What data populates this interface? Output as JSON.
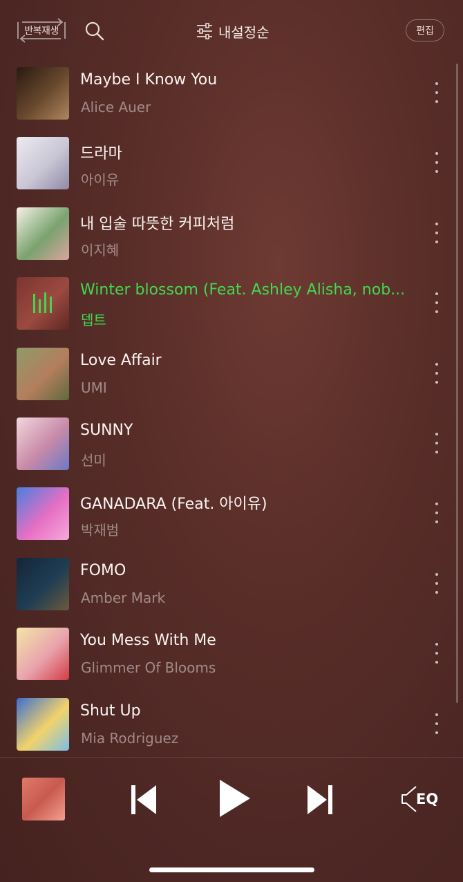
{
  "header": {
    "repeat_label": "반복재생",
    "sort_label": "내설정순",
    "edit_label": "편집"
  },
  "tracks": [
    {
      "title": "Maybe I Know You",
      "artist": "Alice Auer",
      "art_colors": [
        "#2a1a12",
        "#6a4a2e",
        "#b08660"
      ]
    },
    {
      "title": "드라마",
      "artist": "아이유",
      "art_colors": [
        "#ecebef",
        "#c9c6d6",
        "#8f8aa6"
      ]
    },
    {
      "title": "내 입술 따뜻한 커피처럼",
      "artist": "이지혜",
      "art_colors": [
        "#f5f1e6",
        "#7aa36f",
        "#d9a4a0"
      ]
    },
    {
      "title": "Winter blossom (Feat. Ashley Alisha, nob...",
      "artist": "뎁트",
      "art_colors": [
        "#7a3530",
        "#9b4a40",
        "#5e2824"
      ],
      "playing": true
    },
    {
      "title": "Love Affair",
      "artist": "UMI",
      "art_colors": [
        "#8f9a6a",
        "#b47e5c",
        "#5d6a3e"
      ]
    },
    {
      "title": "SUNNY",
      "artist": "선미",
      "art_colors": [
        "#f3d6dc",
        "#c78aa8",
        "#6c79c6"
      ]
    },
    {
      "title": "GANADARA (Feat. 아이유)",
      "artist": "박재범",
      "art_colors": [
        "#4a7fe0",
        "#e66fc3",
        "#f6a9dc"
      ]
    },
    {
      "title": "FOMO",
      "artist": "Amber Mark",
      "art_colors": [
        "#13263a",
        "#1f3d54",
        "#6b5a3c"
      ]
    },
    {
      "title": "You Mess With Me",
      "artist": "Glimmer Of Blooms",
      "art_colors": [
        "#f4e5a8",
        "#e8a3ad",
        "#d33b45"
      ]
    },
    {
      "title": "Shut Up",
      "artist": "Mia Rodriguez",
      "art_colors": [
        "#3d6fd0",
        "#f2d36b",
        "#7bbfe8"
      ]
    }
  ],
  "player": {
    "eq_label": "EQ",
    "mini_art_colors": [
      "#e07a6a",
      "#c85a50",
      "#f4a090"
    ]
  },
  "colors": {
    "playing": "#3fd94f",
    "background": "#5a2e29"
  }
}
